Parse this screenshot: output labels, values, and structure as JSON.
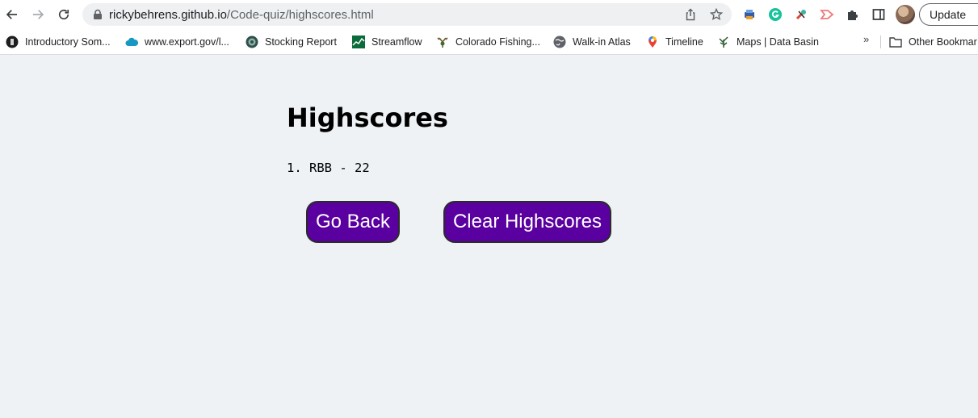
{
  "browser": {
    "url_host": "rickybehrens.github.io",
    "url_path": "/Code-quiz/highscores.html",
    "update_label": "Update"
  },
  "bookmarks": [
    {
      "label": "Introductory Som...",
      "icon": "dark-circle-icon"
    },
    {
      "label": "www.export.gov/l...",
      "icon": "cloud-icon"
    },
    {
      "label": "Stocking Report",
      "icon": "seal-icon"
    },
    {
      "label": "Streamflow",
      "icon": "graph-icon"
    },
    {
      "label": "Colorado Fishing...",
      "icon": "deer-icon"
    },
    {
      "label": "Walk-in Atlas",
      "icon": "globe-icon"
    },
    {
      "label": "Timeline",
      "icon": "map-pin-icon"
    },
    {
      "label": "Maps | Data Basin",
      "icon": "plant-icon"
    }
  ],
  "other_bookmarks": "Other Bookmar",
  "page": {
    "title": "Highscores",
    "scores": [
      {
        "rank": "1.",
        "entry": "RBB - 22"
      }
    ],
    "go_back_label": "Go Back",
    "clear_label": "Clear Highscores"
  },
  "colors": {
    "background": "#eef2f5",
    "button": "#5a00a0"
  }
}
